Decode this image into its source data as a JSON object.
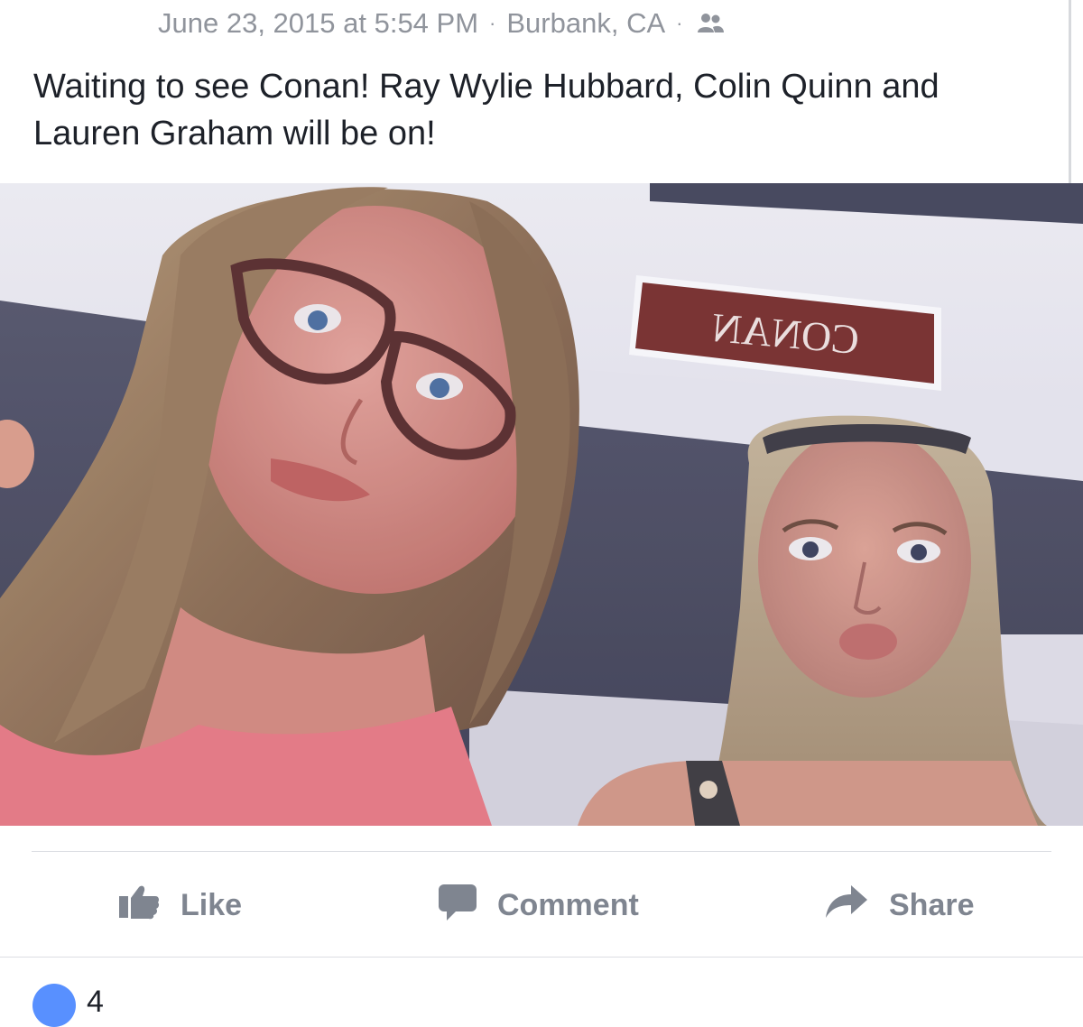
{
  "post": {
    "timestamp": "June 23, 2015 at 5:54 PM",
    "separator": "·",
    "location": "Burbank, CA",
    "audience_icon": "friends-icon",
    "text": "Waiting to see Conan! Ray Wylie Hubbard, Colin Quinn and Lauren Graham will be on!",
    "photo": {
      "sign_text": "CONAN"
    }
  },
  "actions": {
    "like": {
      "label": "Like",
      "icon": "thumbs-up-icon"
    },
    "comment": {
      "label": "Comment",
      "icon": "comment-bubble-icon"
    },
    "share": {
      "label": "Share",
      "icon": "share-arrow-icon"
    }
  },
  "reactions": {
    "count": "4",
    "icon": "like-reaction-icon"
  },
  "colors": {
    "meta_text": "#90949c",
    "body_text": "#1d2129",
    "action_text": "#7f8590",
    "reaction_blue": "#5890ff",
    "sign_background": "#7a2e2a"
  }
}
